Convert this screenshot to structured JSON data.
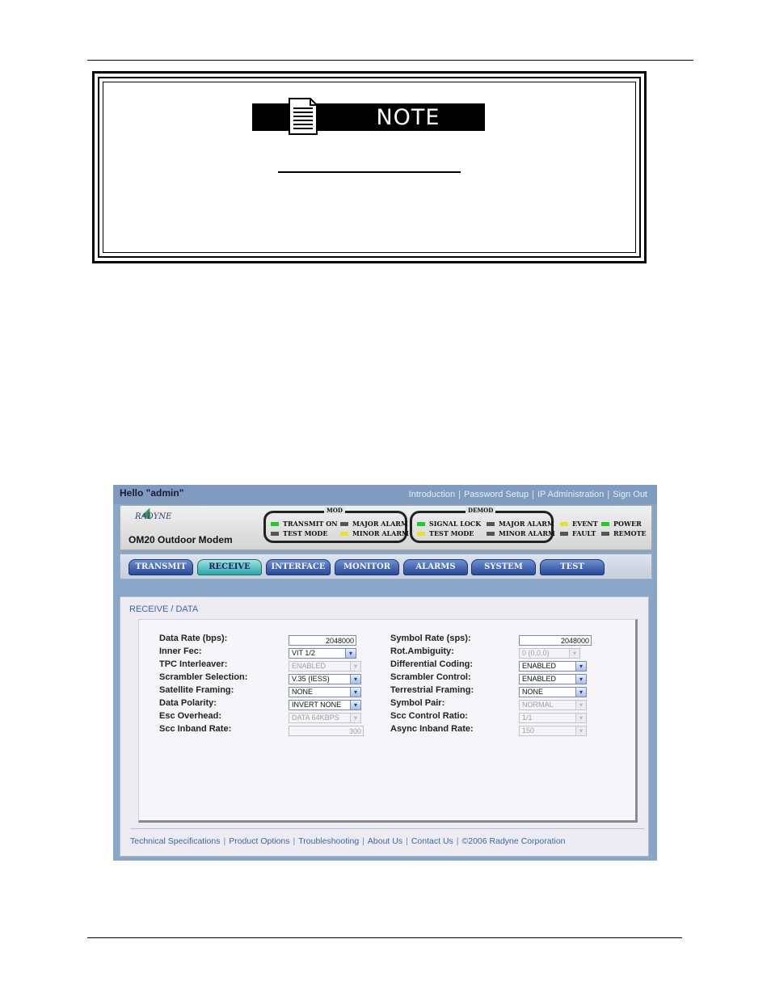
{
  "note": {
    "title": "NOTE"
  },
  "ui": {
    "hello": "Hello \"admin\"",
    "top_links": [
      "Introduction",
      "Password Setup",
      "IP Administration",
      "Sign Out"
    ],
    "logo_text": "RADYNE",
    "model": "OM20 Outdoor Modem",
    "status": {
      "mod_title": "MOD",
      "demod_title": "DEMOD",
      "mod": [
        {
          "label": "TRANSMIT ON",
          "color": "#22cc22"
        },
        {
          "label": "TEST MODE",
          "color": "#555555"
        },
        {
          "label": "MAJOR ALARM",
          "color": "#555555"
        },
        {
          "label": "MINOR ALARM",
          "color": "#e8e030"
        }
      ],
      "demod": [
        {
          "label": "SIGNAL LOCK",
          "color": "#22cc22"
        },
        {
          "label": "TEST MODE",
          "color": "#e8e030"
        },
        {
          "label": "MAJOR ALARM",
          "color": "#555555"
        },
        {
          "label": "MINOR ALARM",
          "color": "#555555"
        }
      ],
      "extra": [
        {
          "label": "EVENT",
          "color": "#e8e030"
        },
        {
          "label": "FAULT",
          "color": "#555555"
        },
        {
          "label": "POWER",
          "color": "#22cc22"
        },
        {
          "label": "REMOTE",
          "color": "#555555"
        }
      ]
    },
    "tabs": [
      "TRANSMIT",
      "RECEIVE",
      "INTERFACE",
      "MONITOR",
      "ALARMS",
      "SYSTEM",
      "TEST"
    ],
    "active_tab": "RECEIVE",
    "breadcrumb": "RECEIVE / DATA",
    "left_fields": [
      {
        "label": "Data Rate (bps):",
        "type": "text",
        "value": "2048000",
        "disabled": false
      },
      {
        "label": "Inner Fec:",
        "type": "select",
        "value": "VIT 1/2",
        "disabled": false
      },
      {
        "label": "TPC Interleaver:",
        "type": "select",
        "value": "ENABLED",
        "disabled": true
      },
      {
        "label": "Scrambler Selection:",
        "type": "select",
        "value": "V.35 (IESS)",
        "disabled": false
      },
      {
        "label": "Satellite Framing:",
        "type": "select",
        "value": "NONE",
        "disabled": false
      },
      {
        "label": "Data Polarity:",
        "type": "select",
        "value": "INVERT NONE",
        "disabled": false
      },
      {
        "label": "Esc Overhead:",
        "type": "select",
        "value": "DATA 64KBPS",
        "disabled": true
      },
      {
        "label": "Scc Inband Rate:",
        "type": "text",
        "value": "300",
        "disabled": true
      }
    ],
    "right_fields": [
      {
        "label": "Symbol Rate (sps):",
        "type": "text",
        "value": "2048000",
        "disabled": false
      },
      {
        "label": "Rot.Ambiguity:",
        "type": "select",
        "value": "0 (0,0,0)",
        "disabled": true
      },
      {
        "label": "Differential Coding:",
        "type": "select",
        "value": "ENABLED",
        "disabled": false
      },
      {
        "label": "Scrambler Control:",
        "type": "select",
        "value": "ENABLED",
        "disabled": false
      },
      {
        "label": "Terrestrial Framing:",
        "type": "select",
        "value": "NONE",
        "disabled": false
      },
      {
        "label": "Symbol Pair:",
        "type": "select",
        "value": "NORMAL",
        "disabled": true
      },
      {
        "label": "Scc Control Ratio:",
        "type": "select",
        "value": "1/1",
        "disabled": true
      },
      {
        "label": "Async Inband Rate:",
        "type": "select",
        "value": "150",
        "disabled": true
      }
    ],
    "footer_links": [
      "Technical Specifications",
      "Product Options",
      "Troubleshooting",
      "About Us",
      "Contact Us",
      "©2006 Radyne Corporation"
    ]
  }
}
